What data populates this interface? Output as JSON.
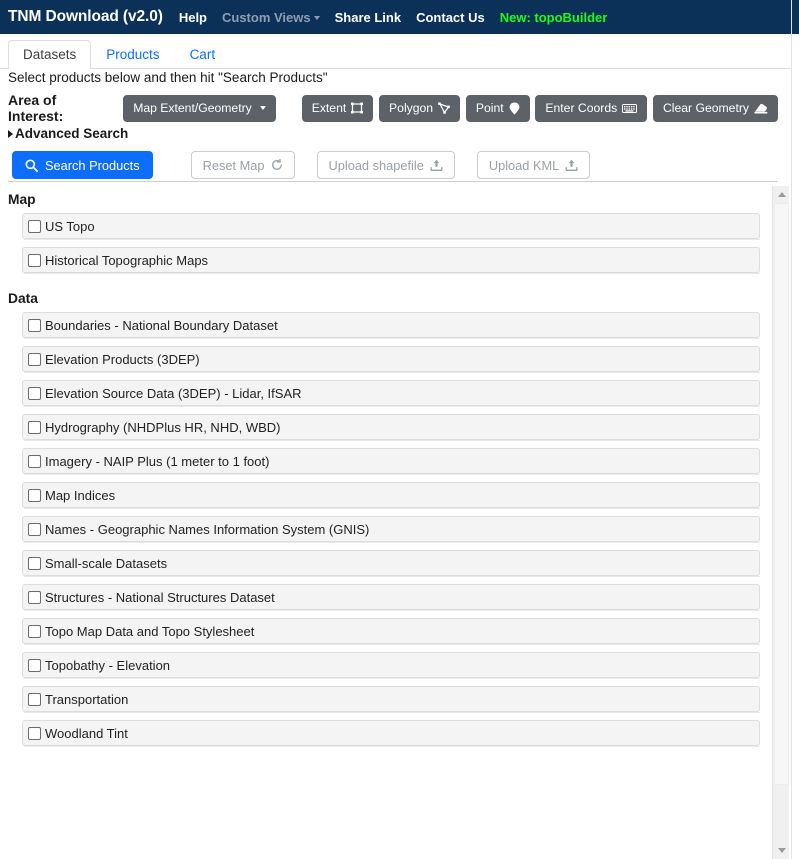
{
  "navbar": {
    "brand": "TNM Download (v2.0)",
    "links": [
      {
        "label": "Help",
        "state": "normal"
      },
      {
        "label": "Custom Views",
        "state": "muted",
        "dropdown": true
      },
      {
        "label": "Share Link",
        "state": "normal"
      },
      {
        "label": "Contact Us",
        "state": "normal"
      },
      {
        "label": "New: topoBuilder",
        "state": "new"
      }
    ],
    "bg_color": "#0b3158",
    "new_color": "#1aff1a"
  },
  "tabs": [
    {
      "label": "Datasets",
      "active": true
    },
    {
      "label": "Products",
      "active": false
    },
    {
      "label": "Cart",
      "active": false
    }
  ],
  "instruction": "Select products below and then hit \"Search Products\"",
  "aoi": {
    "label": "Area of Interest:",
    "map_extent_button": "Map Extent/Geometry",
    "buttons": [
      {
        "label": "Extent",
        "icon": "rectangle-select-icon"
      },
      {
        "label": "Polygon",
        "icon": "polygon-select-icon"
      },
      {
        "label": "Point",
        "icon": "map-pin-icon"
      },
      {
        "label": "Enter Coords",
        "icon": "keyboard-icon"
      },
      {
        "label": "Clear Geometry",
        "icon": "eraser-icon"
      }
    ]
  },
  "advanced_search": {
    "label": "Advanced Search",
    "expanded": false
  },
  "actions": {
    "search": {
      "label": "Search Products",
      "icon": "search-icon",
      "enabled": true
    },
    "reset_map": {
      "label": "Reset Map",
      "icon": "refresh-icon",
      "enabled": false
    },
    "upload_shapefile": {
      "label": "Upload shapefile",
      "icon": "upload-icon",
      "enabled": false
    },
    "upload_kml": {
      "label": "Upload KML",
      "icon": "upload-icon",
      "enabled": false
    }
  },
  "groups": [
    {
      "title": "Map",
      "items": [
        {
          "label": "US Topo",
          "checked": false
        },
        {
          "label": "Historical Topographic Maps",
          "checked": false
        }
      ]
    },
    {
      "title": "Data",
      "items": [
        {
          "label": "Boundaries - National Boundary Dataset",
          "checked": false
        },
        {
          "label": "Elevation Products (3DEP)",
          "checked": false
        },
        {
          "label": "Elevation Source Data (3DEP) - Lidar, IfSAR",
          "checked": false
        },
        {
          "label": "Hydrography (NHDPlus HR, NHD, WBD)",
          "checked": false
        },
        {
          "label": "Imagery - NAIP Plus (1 meter to 1 foot)",
          "checked": false
        },
        {
          "label": "Map Indices",
          "checked": false
        },
        {
          "label": "Names - Geographic Names Information System (GNIS)",
          "checked": false
        },
        {
          "label": "Small-scale Datasets",
          "checked": false
        },
        {
          "label": "Structures - National Structures Dataset",
          "checked": false
        },
        {
          "label": "Topo Map Data and Topo Stylesheet",
          "checked": false
        },
        {
          "label": "Topobathy - Elevation",
          "checked": false
        },
        {
          "label": "Transportation",
          "checked": false
        },
        {
          "label": "Woodland Tint",
          "checked": false
        }
      ]
    }
  ],
  "scrollbar": {
    "up_icon": "scroll-up-arrow-icon",
    "down_icon": "scroll-down-arrow-icon"
  }
}
